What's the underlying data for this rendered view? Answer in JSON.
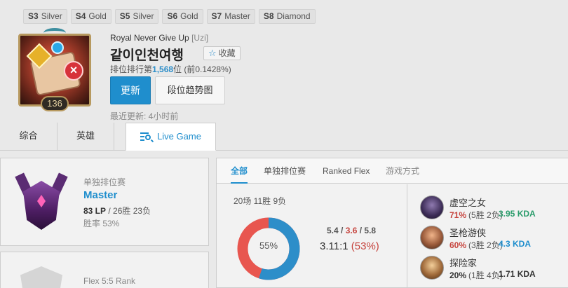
{
  "seasons": [
    {
      "season": "S3",
      "tier": "Silver"
    },
    {
      "season": "S4",
      "tier": "Gold"
    },
    {
      "season": "S5",
      "tier": "Silver"
    },
    {
      "season": "S6",
      "tier": "Gold"
    },
    {
      "season": "S7",
      "tier": "Master"
    },
    {
      "season": "S8",
      "tier": "Diamond"
    }
  ],
  "profile": {
    "level": "136",
    "team": "Royal Never Give Up",
    "tag": "[Uzi]",
    "name": "같이인천여행",
    "favorite_label": "收藏",
    "rank_prefix": "排位排行第",
    "rank_number": "1,568",
    "rank_suffix": "位 (前0.1428%)",
    "update_button": "更新",
    "trend_button": "段位趋势图",
    "last_update": "最近更新: 4小时前"
  },
  "tabs": {
    "overview": "综合",
    "champions": "英雄",
    "live_game": "Live Game"
  },
  "solo_rank": {
    "queue": "单独排位赛",
    "tier": "Master",
    "lp": "83 LP",
    "record": " / 26胜 23负",
    "winrate": "胜率 53%"
  },
  "flex_rank": {
    "queue": "Flex 5:5 Rank"
  },
  "stats_tabs": {
    "all": "全部",
    "solo": "单独排位赛",
    "flex": "Ranked Flex",
    "mode": "游戏方式"
  },
  "summary": {
    "games": "20场 11胜 9负",
    "win_ratio": 0.55,
    "donut_label": "55%",
    "kills": "5.4",
    "deaths": "3.6",
    "assists": "5.8",
    "sep": " / ",
    "ratio": "3.11:1",
    "ratio_pct": "(53%)"
  },
  "champions": [
    {
      "name": "虚空之女",
      "winrate": "71%",
      "record": "(5胜 2负)",
      "kda": "3.95 KDA"
    },
    {
      "name": "圣枪游侠",
      "winrate": "60%",
      "record": "(3胜 2负)",
      "kda": "4.3 KDA"
    },
    {
      "name": "探险家",
      "winrate": "20%",
      "record": "(1胜 4负)",
      "kda": "1.71 KDA"
    }
  ],
  "colors": {
    "accent": "#1f8ecd",
    "win": "#2d8ec9",
    "loss": "#e8564f"
  }
}
